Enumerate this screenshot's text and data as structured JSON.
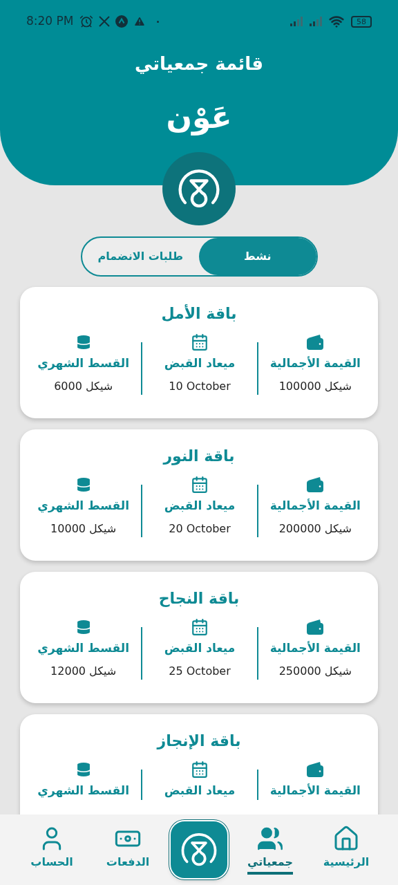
{
  "status_bar": {
    "time": "8:20 PM",
    "battery": "58"
  },
  "header": {
    "title": "قائمة جمعياتي",
    "brand": "عَوْن"
  },
  "tabs": [
    {
      "label": "نشط",
      "selected": true
    },
    {
      "label": "طلبات الانضمام",
      "selected": false
    }
  ],
  "cards": [
    {
      "title": "باقة الأمل",
      "fields": [
        {
          "kind": "total",
          "label": "القيمة الأجمالية",
          "value": "شيكل 100000"
        },
        {
          "kind": "date",
          "label": "ميعاد القبض",
          "value": "10 October"
        },
        {
          "kind": "monthly",
          "label": "القسط الشهري",
          "value": "شيكل 6000"
        }
      ]
    },
    {
      "title": "باقة النور",
      "fields": [
        {
          "kind": "total",
          "label": "القيمة الأجمالية",
          "value": "شيكل 200000"
        },
        {
          "kind": "date",
          "label": "ميعاد القبض",
          "value": "20 October"
        },
        {
          "kind": "monthly",
          "label": "القسط الشهري",
          "value": "شيكل 10000"
        }
      ]
    },
    {
      "title": "باقة النجاح",
      "fields": [
        {
          "kind": "total",
          "label": "القيمة الأجمالية",
          "value": "شيكل 250000"
        },
        {
          "kind": "date",
          "label": "ميعاد القبض",
          "value": "25 October"
        },
        {
          "kind": "monthly",
          "label": "القسط الشهري",
          "value": "شيكل 12000"
        }
      ]
    },
    {
      "title": "باقة الإنجاز",
      "fields": [
        {
          "kind": "total",
          "label": "القيمة الأجمالية"
        },
        {
          "kind": "date",
          "label": "ميعاد القبض"
        },
        {
          "kind": "monthly",
          "label": "القسط الشهري"
        }
      ]
    }
  ],
  "nav": [
    {
      "kind": "home",
      "label": "الرئيسية",
      "selected": false
    },
    {
      "kind": "groups",
      "label": "جمعياتي",
      "selected": true
    },
    {
      "kind": "logo"
    },
    {
      "kind": "payments",
      "label": "الدفعات",
      "selected": false
    },
    {
      "kind": "account",
      "label": "الحساب",
      "selected": false
    }
  ]
}
